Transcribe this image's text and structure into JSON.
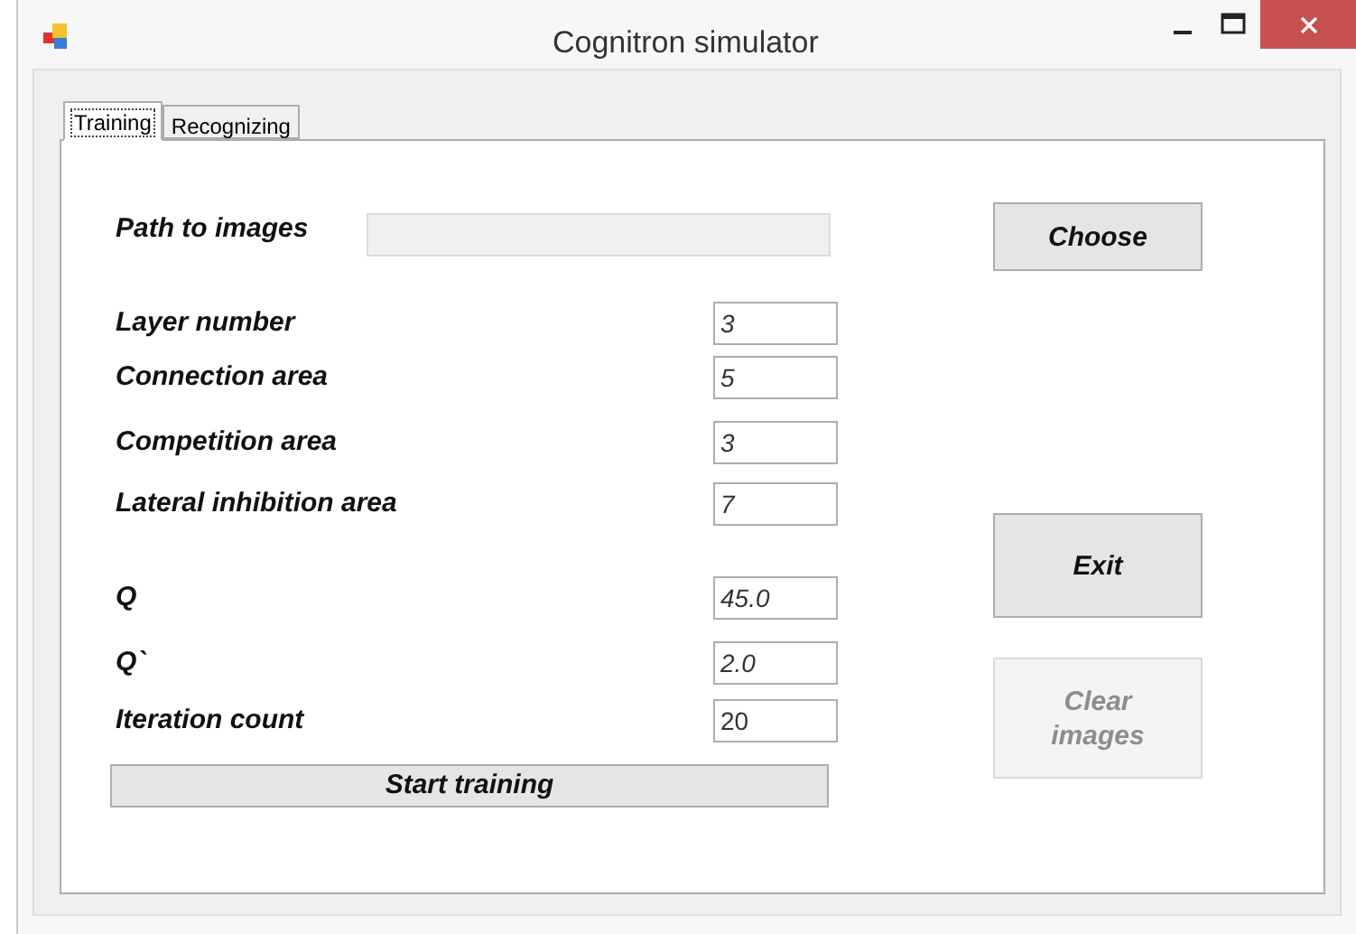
{
  "window": {
    "title": "Cognitron simulator"
  },
  "tabs": [
    {
      "label": "Training",
      "selected": true
    },
    {
      "label": "Recognizing",
      "selected": false
    }
  ],
  "path": {
    "label": "Path to images",
    "disabled": true
  },
  "fields": [
    {
      "label": "Layer number",
      "value": "3",
      "italic": true
    },
    {
      "label": "Connection area",
      "value": "5",
      "italic": true
    },
    {
      "label": "Competition area",
      "value": "3",
      "italic": true
    },
    {
      "label": "Lateral inhibition area",
      "value": "7",
      "italic": true
    },
    {
      "label": "Q",
      "value": "45.0",
      "italic": true
    },
    {
      "label": "Q`",
      "value": "2.0",
      "italic": true
    },
    {
      "label": "Iteration count",
      "value": "20",
      "italic": false
    }
  ],
  "start_button": {
    "label": "Start training"
  },
  "buttons": [
    {
      "label": "Choose",
      "disabled": false
    },
    {
      "label": "Exit",
      "disabled": false
    },
    {
      "label": "Clear images",
      "disabled": true
    }
  ]
}
